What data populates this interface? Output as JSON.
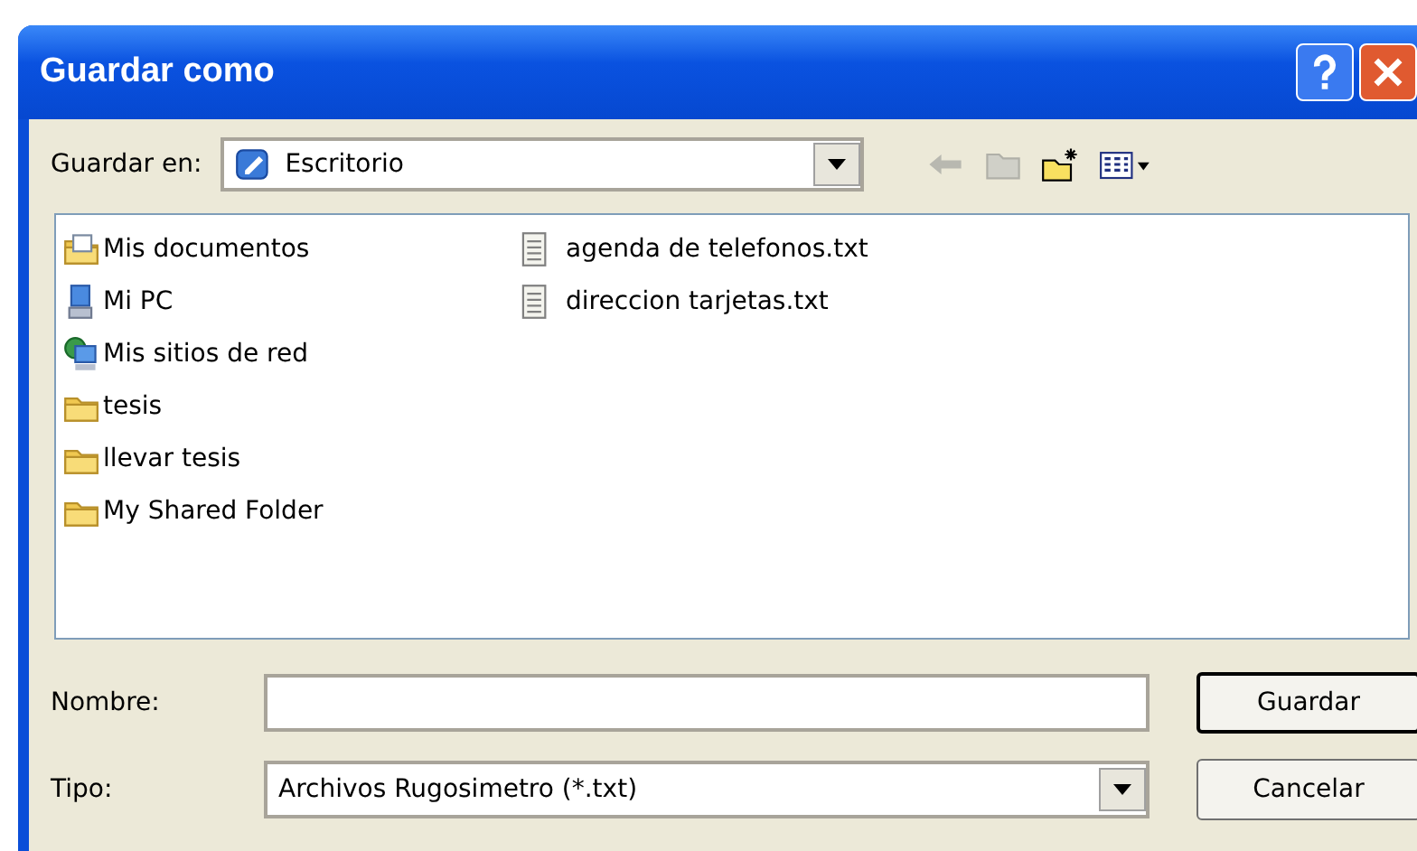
{
  "window": {
    "title": "Guardar como"
  },
  "title_buttons": [
    {
      "kind": "help"
    },
    {
      "kind": "close"
    }
  ],
  "save_in": {
    "label": "Guardar en:",
    "value": "Escritorio"
  },
  "toolbar": [
    {
      "kind": "back",
      "disabled": true
    },
    {
      "kind": "up",
      "disabled": true
    },
    {
      "kind": "new-folder",
      "disabled": false
    },
    {
      "kind": "views",
      "disabled": false
    }
  ],
  "files": [
    {
      "name": "Mis documentos",
      "kind": "documents"
    },
    {
      "name": "Mi PC",
      "kind": "computer"
    },
    {
      "name": "Mis sitios de red",
      "kind": "network"
    },
    {
      "name": "tesis",
      "kind": "folder"
    },
    {
      "name": "llevar tesis",
      "kind": "folder"
    },
    {
      "name": "My Shared Folder",
      "kind": "folder"
    },
    {
      "name": "agenda de telefonos.txt",
      "kind": "text"
    },
    {
      "name": "direccion tarjetas.txt",
      "kind": "text"
    }
  ],
  "filename": {
    "label": "Nombre:"
  },
  "filetype": {
    "label": "Tipo:",
    "value": "Archivos Rugosimetro (*.txt)"
  },
  "buttons": [
    {
      "label": "Guardar",
      "default": true
    },
    {
      "label": "Cancelar",
      "default": false
    }
  ]
}
